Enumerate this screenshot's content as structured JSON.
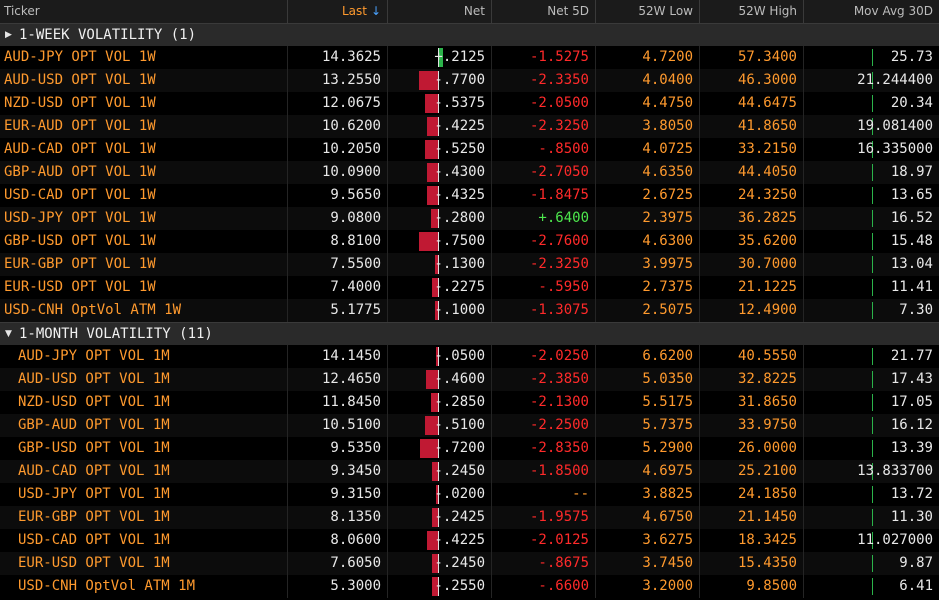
{
  "columns": {
    "ticker": "Ticker",
    "last": "Last",
    "last_sort_icon": "↓",
    "net": "Net",
    "net5d": "Net 5D",
    "low52": "52W Low",
    "high52": "52W High",
    "mov30": "Mov Avg 30D"
  },
  "colors": {
    "ticker": "#ff9a2e",
    "negative": "#ff2a2a",
    "positive": "#4de84d",
    "bar_negative": "#c01933",
    "bar_positive": "#2bb34a"
  },
  "groups": [
    {
      "title": "1-WEEK VOLATILITY (1)",
      "toggle_icon": "triangle-right-icon",
      "toggle_glyph": "▶",
      "rows": [
        {
          "ticker": "AUD-JPY OPT VOL 1W",
          "last": "14.3625",
          "net": "+.2125",
          "net_value": 0.2125,
          "net5d": "-1.5275",
          "low": "4.7200",
          "high": "57.3400",
          "mov": "25.73"
        },
        {
          "ticker": "AUD-USD OPT VOL 1W",
          "last": "13.2550",
          "net": "-.7700",
          "net_value": -0.77,
          "net5d": "-2.3350",
          "low": "4.0400",
          "high": "46.3000",
          "mov": "21.244400"
        },
        {
          "ticker": "NZD-USD OPT VOL 1W",
          "last": "12.0675",
          "net": "-.5375",
          "net_value": -0.5375,
          "net5d": "-2.0500",
          "low": "4.4750",
          "high": "44.6475",
          "mov": "20.34"
        },
        {
          "ticker": "EUR-AUD OPT VOL  1W",
          "last": "10.6200",
          "net": "-.4225",
          "net_value": -0.4225,
          "net5d": "-2.3250",
          "low": "3.8050",
          "high": "41.8650",
          "mov": "19.081400"
        },
        {
          "ticker": "AUD-CAD OPT VOL 1W",
          "last": "10.2050",
          "net": "-.5250",
          "net_value": -0.525,
          "net5d": "-.8500",
          "low": "4.0725",
          "high": "33.2150",
          "mov": "16.335000"
        },
        {
          "ticker": "GBP-AUD OPT VOL 1W",
          "last": "10.0900",
          "net": "-.4300",
          "net_value": -0.43,
          "net5d": "-2.7050",
          "low": "4.6350",
          "high": "44.4050",
          "mov": "18.97"
        },
        {
          "ticker": "USD-CAD OPT VOL 1W",
          "last": "9.5650",
          "net": "-.4325",
          "net_value": -0.4325,
          "net5d": "-1.8475",
          "low": "2.6725",
          "high": "24.3250",
          "mov": "13.65"
        },
        {
          "ticker": "USD-JPY OPT VOL 1W",
          "last": "9.0800",
          "net": "-.2800",
          "net_value": -0.28,
          "net5d": "+.6400",
          "low": "2.3975",
          "high": "36.2825",
          "mov": "16.52"
        },
        {
          "ticker": "GBP-USD OPT VOL 1W",
          "last": "8.8100",
          "net": "-.7500",
          "net_value": -0.75,
          "net5d": "-2.7600",
          "low": "4.6300",
          "high": "35.6200",
          "mov": "15.48"
        },
        {
          "ticker": "EUR-GBP OPT VOL 1W",
          "last": "7.5500",
          "net": "-.1300",
          "net_value": -0.13,
          "net5d": "-2.3250",
          "low": "3.9975",
          "high": "30.7000",
          "mov": "13.04"
        },
        {
          "ticker": "EUR-USD OPT VOL 1W",
          "last": "7.4000",
          "net": "-.2275",
          "net_value": -0.2275,
          "net5d": "-.5950",
          "low": "2.7375",
          "high": "21.1225",
          "mov": "11.41"
        },
        {
          "ticker": "USD-CNH OptVol ATM 1W",
          "last": "5.1775",
          "net": "-.1000",
          "net_value": -0.1,
          "net5d": "-1.3075",
          "low": "2.5075",
          "high": "12.4900",
          "mov": "7.30"
        }
      ]
    },
    {
      "title": "1-MONTH VOLATILITY (11)",
      "toggle_icon": "triangle-down-icon",
      "toggle_glyph": "▼",
      "rows": [
        {
          "ticker": "AUD-JPY OPT VOL 1M",
          "last": "14.1450",
          "net": "-.0500",
          "net_value": -0.05,
          "net5d": "-2.0250",
          "low": "6.6200",
          "high": "40.5550",
          "mov": "21.77"
        },
        {
          "ticker": "AUD-USD OPT VOL 1M",
          "last": "12.4650",
          "net": "-.4600",
          "net_value": -0.46,
          "net5d": "-2.3850",
          "low": "5.0350",
          "high": "32.8225",
          "mov": "17.43"
        },
        {
          "ticker": "NZD-USD OPT VOL 1M",
          "last": "11.8450",
          "net": "-.2850",
          "net_value": -0.285,
          "net5d": "-2.1300",
          "low": "5.5175",
          "high": "31.8650",
          "mov": "17.05"
        },
        {
          "ticker": "GBP-AUD OPT VOL 1M",
          "last": "10.5100",
          "net": "-.5100",
          "net_value": -0.51,
          "net5d": "-2.2500",
          "low": "5.7375",
          "high": "33.9750",
          "mov": "16.12"
        },
        {
          "ticker": "GBP-USD OPT VOL 1M",
          "last": "9.5350",
          "net": "-.7200",
          "net_value": -0.72,
          "net5d": "-2.8350",
          "low": "5.2900",
          "high": "26.0000",
          "mov": "13.39"
        },
        {
          "ticker": "AUD-CAD OPT VOL 1M",
          "last": "9.3450",
          "net": "-.2450",
          "net_value": -0.245,
          "net5d": "-1.8500",
          "low": "4.6975",
          "high": "25.2100",
          "mov": "13.833700"
        },
        {
          "ticker": "USD-JPY OPT VOL 1M",
          "last": "9.3150",
          "net": "-.0200",
          "net_value": -0.02,
          "net5d": "--",
          "low": "3.8825",
          "high": "24.1850",
          "mov": "13.72"
        },
        {
          "ticker": "EUR-GBP OPT VOL 1M",
          "last": "8.1350",
          "net": "-.2425",
          "net_value": -0.2425,
          "net5d": "-1.9575",
          "low": "4.6750",
          "high": "21.1450",
          "mov": "11.30"
        },
        {
          "ticker": "USD-CAD OPT VOL 1M",
          "last": "8.0600",
          "net": "-.4225",
          "net_value": -0.4225,
          "net5d": "-2.0125",
          "low": "3.6275",
          "high": "18.3425",
          "mov": "11.027000"
        },
        {
          "ticker": "EUR-USD OPT VOL 1M",
          "last": "7.6050",
          "net": "-.2450",
          "net_value": -0.245,
          "net5d": "-.8675",
          "low": "3.7450",
          "high": "15.4350",
          "mov": "9.87"
        },
        {
          "ticker": "USD-CNH OptVol ATM 1M",
          "last": "5.3000",
          "net": "-.2550",
          "net_value": -0.255,
          "net5d": "-.6600",
          "low": "3.2000",
          "high": "9.8500",
          "mov": "6.41"
        }
      ]
    }
  ]
}
